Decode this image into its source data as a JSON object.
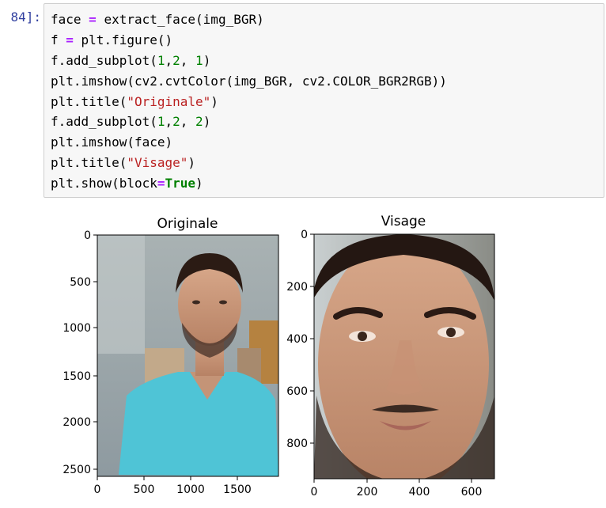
{
  "cell": {
    "prompt": "84]:",
    "code_lines": [
      [
        {
          "t": "face "
        },
        {
          "t": "=",
          "c": "op"
        },
        {
          "t": " extract_face(img_BGR)"
        }
      ],
      [
        {
          "t": "f "
        },
        {
          "t": "=",
          "c": "op"
        },
        {
          "t": " plt.figure()"
        }
      ],
      [
        {
          "t": "f.add_subplot("
        },
        {
          "t": "1",
          "c": "num"
        },
        {
          "t": ","
        },
        {
          "t": "2",
          "c": "num"
        },
        {
          "t": ", "
        },
        {
          "t": "1",
          "c": "num"
        },
        {
          "t": ")"
        }
      ],
      [
        {
          "t": "plt.imshow(cv2.cvtColor(img_BGR, cv2.COLOR_BGR2RGB))"
        }
      ],
      [
        {
          "t": "plt.title("
        },
        {
          "t": "\"Originale\"",
          "c": "str"
        },
        {
          "t": ")"
        }
      ],
      [
        {
          "t": "f.add_subplot("
        },
        {
          "t": "1",
          "c": "num"
        },
        {
          "t": ","
        },
        {
          "t": "2",
          "c": "num"
        },
        {
          "t": ", "
        },
        {
          "t": "2",
          "c": "num"
        },
        {
          "t": ")"
        }
      ],
      [
        {
          "t": "plt.imshow(face)"
        }
      ],
      [
        {
          "t": "plt.title("
        },
        {
          "t": "\"Visage\"",
          "c": "str"
        },
        {
          "t": ")"
        }
      ],
      [
        {
          "t": "plt.show(block"
        },
        {
          "t": "=",
          "c": "op"
        },
        {
          "t": "True",
          "c": "kw"
        },
        {
          "t": ")"
        }
      ]
    ]
  },
  "colors": {
    "prompt": "#303f9f",
    "operator": "#aa22ff",
    "number": "#008000",
    "string": "#ba2121",
    "keyword": "#008000"
  },
  "output": {
    "panels": [
      {
        "title": "Originale",
        "x_ticks": [
          "0",
          "500",
          "1000",
          "1500"
        ],
        "y_ticks": [
          "0",
          "500",
          "1000",
          "1500",
          "2000",
          "2500"
        ],
        "image_content": "photo-original"
      },
      {
        "title": "Visage",
        "x_ticks": [
          "0",
          "200",
          "400",
          "600"
        ],
        "y_ticks": [
          "0",
          "200",
          "400",
          "600",
          "800"
        ],
        "image_content": "photo-face-crop"
      }
    ]
  }
}
